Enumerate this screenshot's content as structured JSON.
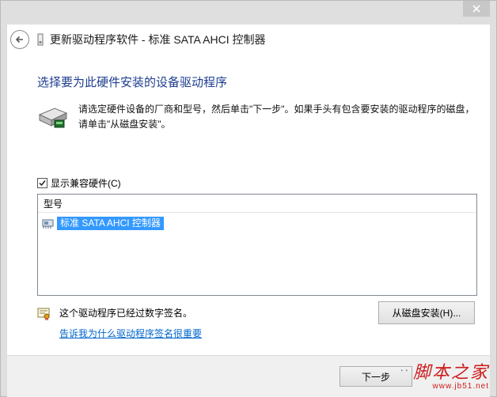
{
  "window": {
    "title": "更新驱动程序软件 - 标准 SATA AHCI 控制器"
  },
  "main": {
    "section_title": "选择要为此硬件安装的设备驱动程序",
    "instruction": "请选定硬件设备的厂商和型号，然后单击\"下一步\"。如果手头有包含要安装的驱动程序的磁盘，请单击\"从磁盘安装\"。",
    "show_compatible_label": "显示兼容硬件(C)",
    "show_compatible_checked": true,
    "list": {
      "column_header": "型号",
      "items": [
        {
          "label": "标准 SATA AHCI 控制器",
          "selected": true
        }
      ]
    },
    "signed_text": "这个驱动程序已经过数字签名。",
    "signing_link": "告诉我为什么驱动程序签名很重要",
    "from_disk_button": "从磁盘安装(H)...",
    "next_button": "下一步"
  },
  "watermark": {
    "brand": "脚本之家",
    "url": "www.jb51.net"
  },
  "icons": {
    "back": "back-arrow-icon",
    "device": "device-icon",
    "hard_drive": "hard-drive-icon",
    "controller": "controller-icon",
    "signed_certificate": "signed-certificate-icon",
    "close": "close-icon",
    "checkmark": "checkmark-icon"
  },
  "colors": {
    "selection": "#3399ff",
    "title_blue": "#1e3d8f",
    "link": "#0066cc",
    "watermark_red": "#cc1b1b"
  }
}
